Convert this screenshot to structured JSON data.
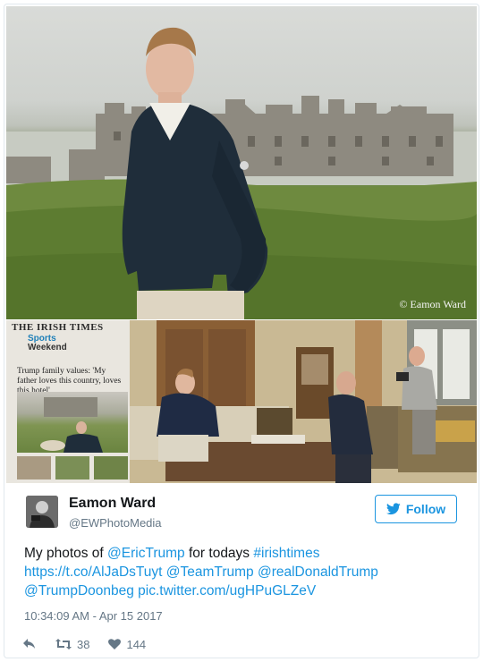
{
  "photo": {
    "credit": "© Eamon Ward"
  },
  "newspaper": {
    "masthead": "THE IRISH TIMES",
    "section_line1": "Sports",
    "section_line2": "Weekend",
    "headline": "Trump family values: 'My father loves this country, loves this hotel'"
  },
  "tweet": {
    "author_name": "Eamon Ward",
    "author_handle": "@EWPhotoMedia",
    "follow_label": "Follow",
    "text_prefix": "My photos of ",
    "mention_eric": "@EricTrump",
    "text_mid": " for todays ",
    "hashtag": "#irishtimes",
    "link_url": "https://t.co/AlJaDsTuyt",
    "mention_team": "@TeamTrump",
    "mention_donald": "@realDonaldTrump",
    "mention_doonbeg": "@TrumpDoonbeg",
    "pic_link": "pic.twitter.com/ugHPuGLZeV",
    "timestamp": "10:34:09 AM - Apr 15 2017",
    "retweet_count": "38",
    "like_count": "144"
  },
  "colors": {
    "link": "#1b95e0",
    "text": "#14171a",
    "muted": "#657786"
  },
  "icons": [
    "twitter-bird-icon",
    "reply-icon",
    "retweet-icon",
    "heart-icon"
  ]
}
